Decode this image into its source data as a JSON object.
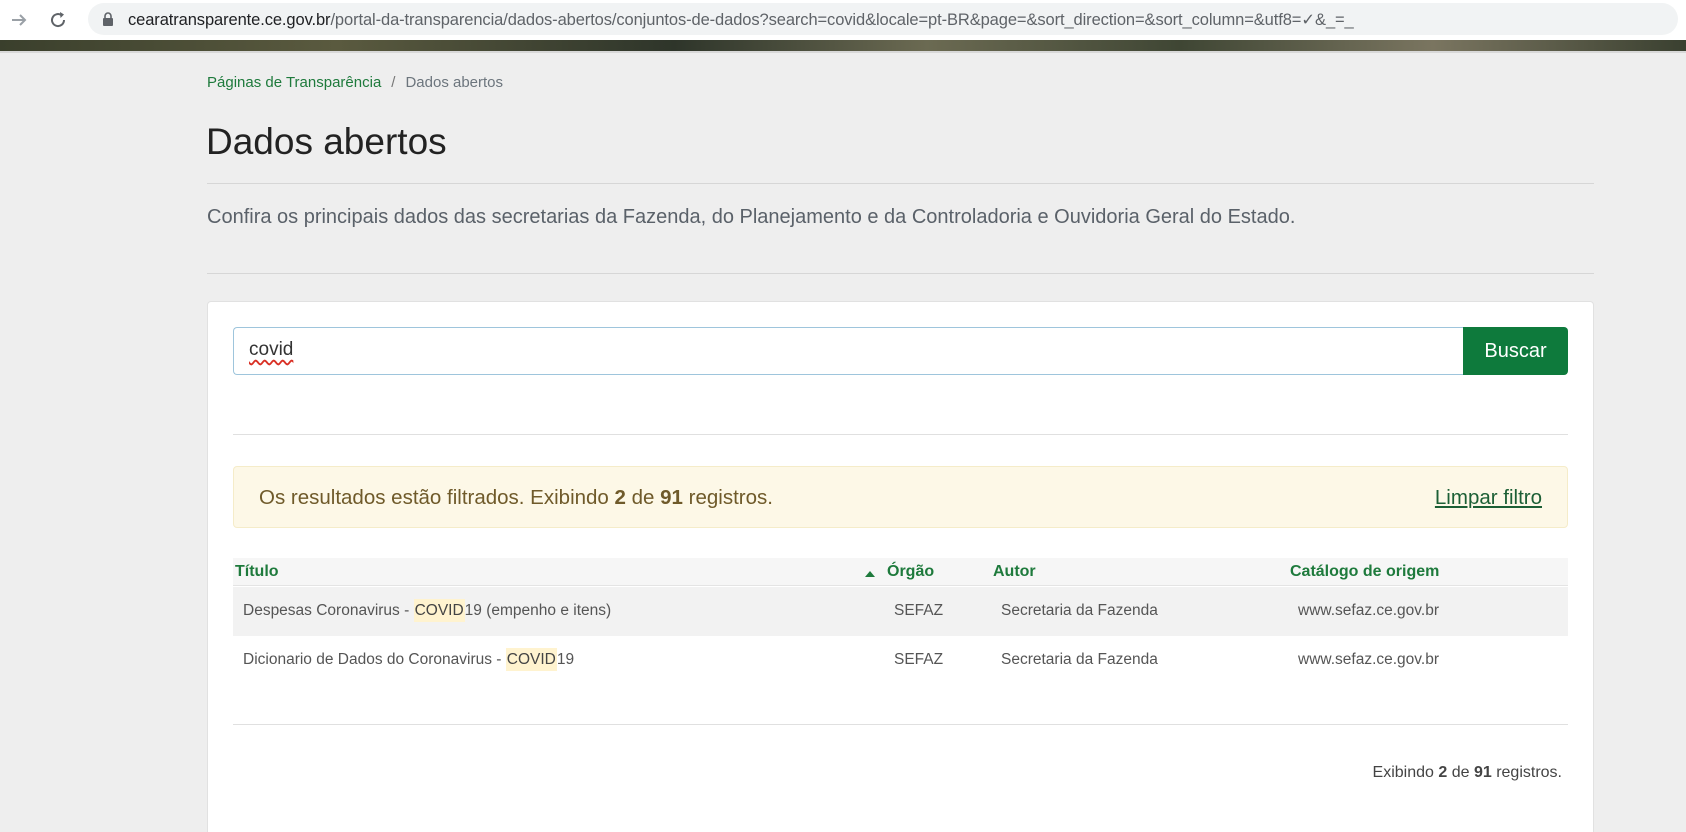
{
  "browser": {
    "url_host": "cearatransparente.ce.gov.br",
    "url_path": "/portal-da-transparencia/dados-abertos/conjuntos-de-dados?search=covid&locale=pt-BR&page=&sort_direction=&sort_column=&utf8=✓&_=_"
  },
  "breadcrumb": {
    "parent": "Páginas de Transparência",
    "separator": "/",
    "current": "Dados abertos"
  },
  "page": {
    "title": "Dados abertos",
    "lead": "Confira os principais dados das secretarias da Fazenda, do Planejamento e da Controladoria e Ouvidoria Geral do Estado."
  },
  "search": {
    "value": "covid",
    "button_label": "Buscar"
  },
  "alert": {
    "prefix": "Os resultados estão filtrados. Exibindo ",
    "shown": "2",
    "middle": " de ",
    "total": "91",
    "suffix": " registros.",
    "clear_label": "Limpar filtro"
  },
  "table": {
    "columns": [
      "Título",
      "Órgão",
      "Autor",
      "Catálogo de origem"
    ],
    "rows": [
      {
        "title_before": "Despesas Coronavirus - ",
        "title_highlight": "COVID",
        "title_after": "19 (empenho e itens)",
        "orgao": "SEFAZ",
        "autor": "Secretaria da Fazenda",
        "catalogo": "www.sefaz.ce.gov.br"
      },
      {
        "title_before": "Dicionario de Dados do Coronavirus - ",
        "title_highlight": "COVID",
        "title_after": "19",
        "orgao": "SEFAZ",
        "autor": "Secretaria da Fazenda",
        "catalogo": "www.sefaz.ce.gov.br"
      }
    ]
  },
  "footer": {
    "prefix": "Exibindo ",
    "shown": "2",
    "middle": " de ",
    "total": "91",
    "suffix": " registros."
  }
}
